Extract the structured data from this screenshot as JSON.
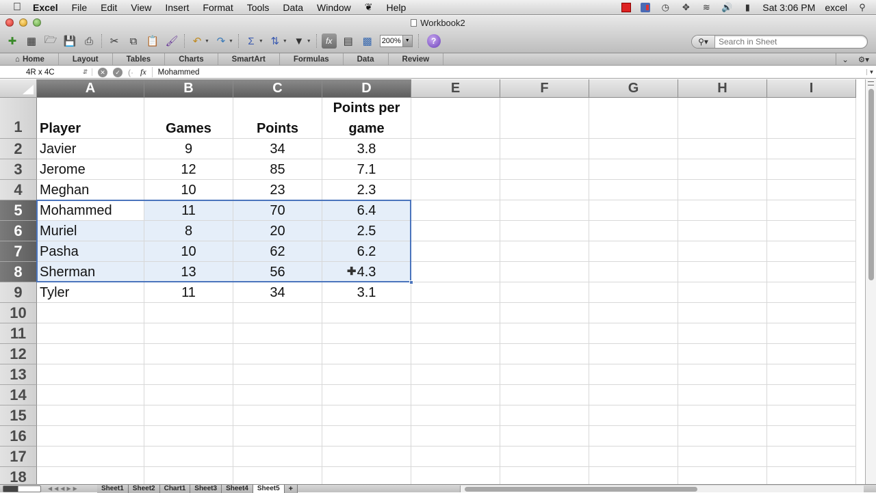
{
  "menubar": {
    "app": "Excel",
    "items": [
      "File",
      "Edit",
      "View",
      "Insert",
      "Format",
      "Tools",
      "Data",
      "Window",
      "Help"
    ],
    "clock": "Sat 3:06 PM",
    "user": "excel"
  },
  "window": {
    "title": "Workbook2"
  },
  "toolbar": {
    "zoom": "200%",
    "search_placeholder": "Search in Sheet",
    "buttons": [
      "new-from-template",
      "gallery",
      "open",
      "save",
      "print",
      "cut",
      "copy",
      "paste",
      "format-painter",
      "undo",
      "redo",
      "autosum",
      "sort",
      "filter",
      "toggle-formula-builder",
      "show-hide-toolbox",
      "media-browser",
      "help"
    ]
  },
  "ribbon": {
    "tabs": [
      "Home",
      "Layout",
      "Tables",
      "Charts",
      "SmartArt",
      "Formulas",
      "Data",
      "Review"
    ]
  },
  "formula_bar": {
    "name_box": "4R x 4C",
    "fx": "fx",
    "content": "Mohammed"
  },
  "sheet": {
    "columns": [
      "A",
      "B",
      "C",
      "D",
      "E",
      "F",
      "G",
      "H",
      "I"
    ],
    "selected_columns": [
      "A",
      "B",
      "C",
      "D"
    ],
    "rows": [
      "1",
      "2",
      "3",
      "4",
      "5",
      "6",
      "7",
      "8",
      "9",
      "10",
      "11",
      "12",
      "13",
      "14",
      "15",
      "16",
      "17",
      "18"
    ],
    "selected_rows": [
      "5",
      "6",
      "7",
      "8"
    ],
    "selection_range": "A5:D8",
    "active_cell": "A5",
    "header": {
      "player": "Player",
      "games": "Games",
      "points": "Points",
      "ppg_line1": "Points per",
      "ppg_line2": "game"
    },
    "data": [
      {
        "player": "Javier",
        "games": "9",
        "points": "34",
        "ppg": "3.8"
      },
      {
        "player": "Jerome",
        "games": "12",
        "points": "85",
        "ppg": "7.1"
      },
      {
        "player": "Meghan",
        "games": "10",
        "points": "23",
        "ppg": "2.3"
      },
      {
        "player": "Mohammed",
        "games": "11",
        "points": "70",
        "ppg": "6.4"
      },
      {
        "player": "Muriel",
        "games": "8",
        "points": "20",
        "ppg": "2.5"
      },
      {
        "player": "Pasha",
        "games": "10",
        "points": "62",
        "ppg": "6.2"
      },
      {
        "player": "Sherman",
        "games": "13",
        "points": "56",
        "ppg": "4.3"
      },
      {
        "player": "Tyler",
        "games": "11",
        "points": "34",
        "ppg": "3.1"
      }
    ]
  },
  "sheet_tabs": {
    "tabs": [
      "Sheet1",
      "Sheet2",
      "Chart1",
      "Sheet3",
      "Sheet4",
      "Sheet5"
    ],
    "active": "Sheet5",
    "add": "+"
  },
  "colors": {
    "selection_border": "#4a74bc",
    "selection_fill": "#e5eef9",
    "selected_header": "#6a6a6a"
  }
}
